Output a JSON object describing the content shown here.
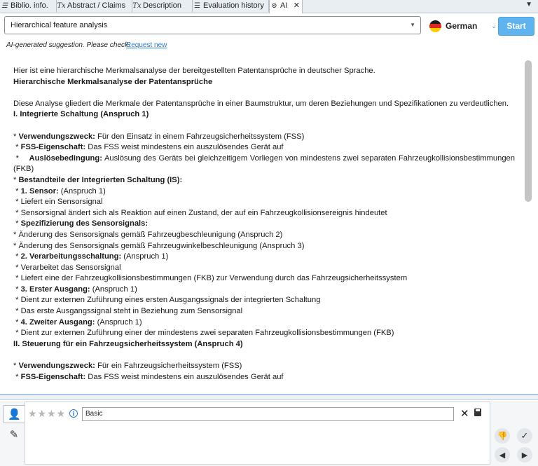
{
  "tabs": [
    {
      "label": "Biblio. info.",
      "icon": "list-icon"
    },
    {
      "label": "Abstract / Claims",
      "icon": "text-format-icon"
    },
    {
      "label": "Description",
      "icon": "text-format-icon"
    },
    {
      "label": "Evaluation history",
      "icon": "list-icon"
    },
    {
      "label": "AI",
      "icon": "ai-icon"
    }
  ],
  "toolbar": {
    "analysis_select": "Hierarchical feature analysis",
    "language": "German",
    "start_label": "Start"
  },
  "notice": {
    "text": "AI-generated suggestion. Please check.",
    "link": "Request new"
  },
  "result": {
    "intro": "Hier ist eine hierarchische Merkmalsanalyse der bereitgestellten Patentansprüche in deutscher Sprache.",
    "heading": "Hierarchische Merkmalsanalyse der Patentansprüche",
    "description": "Diese Analyse gliedert die Merkmale der Patentansprüche in einer Baumstruktur, um deren Beziehungen und Spezifikationen zu verdeutlichen.",
    "section1": "I. Integrierte Schaltung (Anspruch 1)",
    "s1_use_label": "Verwendungszweck:",
    "s1_use_text": " Für den Einsatz in einem Fahrzeugsicherheitssystem (FSS)",
    "s1_fss_label": "FSS-Eigenschaft:",
    "s1_fss_text": " Das FSS weist mindestens ein auszulösendes Gerät auf",
    "s1_trigger_label": "Auslösebedingung:",
    "s1_trigger_text": " Auslösung des Geräts bei gleichzeitigem Vorliegen von mindestens zwei separaten Fahrzeugkollisionsbestimmungen (FKB)",
    "components": "Bestandteile der Integrierten Schaltung (IS):",
    "sensor_label": "1. Sensor:",
    "sensor_ref": " (Anspruch 1)",
    "sensor_l1": "Liefert ein Sensorsignal",
    "sensor_l2": "Sensorsignal ändert sich als Reaktion auf einen Zustand, der auf ein Fahrzeugkollisionsereignis hindeutet",
    "spec_label": "Spezifizierung des Sensorsignals:",
    "spec_l1": "Änderung des Sensorsignals gemäß Fahrzeugbeschleunigung (Anspruch 2)",
    "spec_l2": "Änderung des Sensorsignals gemäß Fahrzeugwinkelbeschleunigung (Anspruch 3)",
    "proc_label": "2. Verarbeitungsschaltung:",
    "proc_ref": " (Anspruch 1)",
    "proc_l1": "Verarbeitet das Sensorsignal",
    "proc_l2": "Liefert eine der Fahrzeugkollisionsbestimmungen (FKB) zur Verwendung durch das Fahrzeugsicherheitssystem",
    "out1_label": "3. Erster Ausgang:",
    "out1_ref": " (Anspruch 1)",
    "out1_l1": "Dient zur externen Zuführung eines ersten Ausgangssignals der integrierten Schaltung",
    "out1_l2": "Das erste Ausgangssignal steht in Beziehung zum Sensorsignal",
    "out2_label": "4. Zweiter Ausgang:",
    "out2_ref": " (Anspruch 1)",
    "out2_l1": "Dient zur externen Zuführung einer der mindestens zwei separaten Fahrzeugkollisionsbestimmungen (FKB)",
    "section2": "II. Steuerung für ein Fahrzeugsicherheitssystem (Anspruch 4)",
    "s2_use_label": "Verwendungszweck:",
    "s2_use_text": " Für ein Fahrzeugsicherheitssystem (FSS)",
    "s2_fss_label": "FSS-Eigenschaft:",
    "s2_fss_text": " Das FSS weist mindestens ein auszulösendes Gerät auf"
  },
  "feedback": {
    "rating": 0,
    "rating_max": 5,
    "comment": "Basic"
  },
  "colors": {
    "accent": "#5fb3ee",
    "link": "#2e7bc6",
    "tabbar": "#e9eef3"
  }
}
